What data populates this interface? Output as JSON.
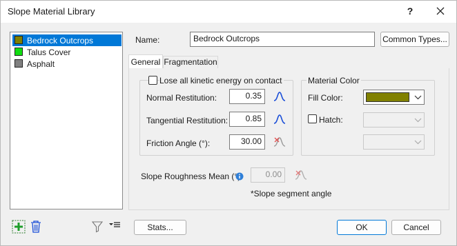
{
  "window": {
    "title": "Slope Material Library",
    "help_glyph": "?",
    "close_icon": "close-icon"
  },
  "materials": [
    {
      "name": "Bedrock Outcrops",
      "color": "#808000",
      "selected": true
    },
    {
      "name": "Talus Cover",
      "color": "#11dd11",
      "selected": false
    },
    {
      "name": "Asphalt",
      "color": "#808080",
      "selected": false
    }
  ],
  "name_field": {
    "label": "Name:",
    "value": "Bedrock Outcrops"
  },
  "common_types_button": "Common Types...",
  "tabs": [
    {
      "label": "General",
      "active": true
    },
    {
      "label": "Fragmentation",
      "active": false
    }
  ],
  "general": {
    "lose_energy": {
      "label": "Lose all kinetic energy on contact",
      "checked": false
    },
    "normal_restitution": {
      "label": "Normal Restitution:",
      "value": "0.35"
    },
    "tangential_restitution": {
      "label": "Tangential Restitution:",
      "value": "0.85"
    },
    "friction_angle": {
      "label": "Friction Angle (°):",
      "value": "30.00"
    },
    "material_color": {
      "title": "Material Color",
      "fill_label": "Fill Color:",
      "fill_color": "#808000",
      "hatch_label": "Hatch:",
      "hatch_checked": false
    },
    "roughness": {
      "label": "Slope Roughness Mean (°):",
      "value": "0.00"
    },
    "note": "*Slope segment angle"
  },
  "footer": {
    "stats_button": "Stats...",
    "ok_button": "OK",
    "cancel_button": "Cancel"
  },
  "accent_color": "#0078d7"
}
